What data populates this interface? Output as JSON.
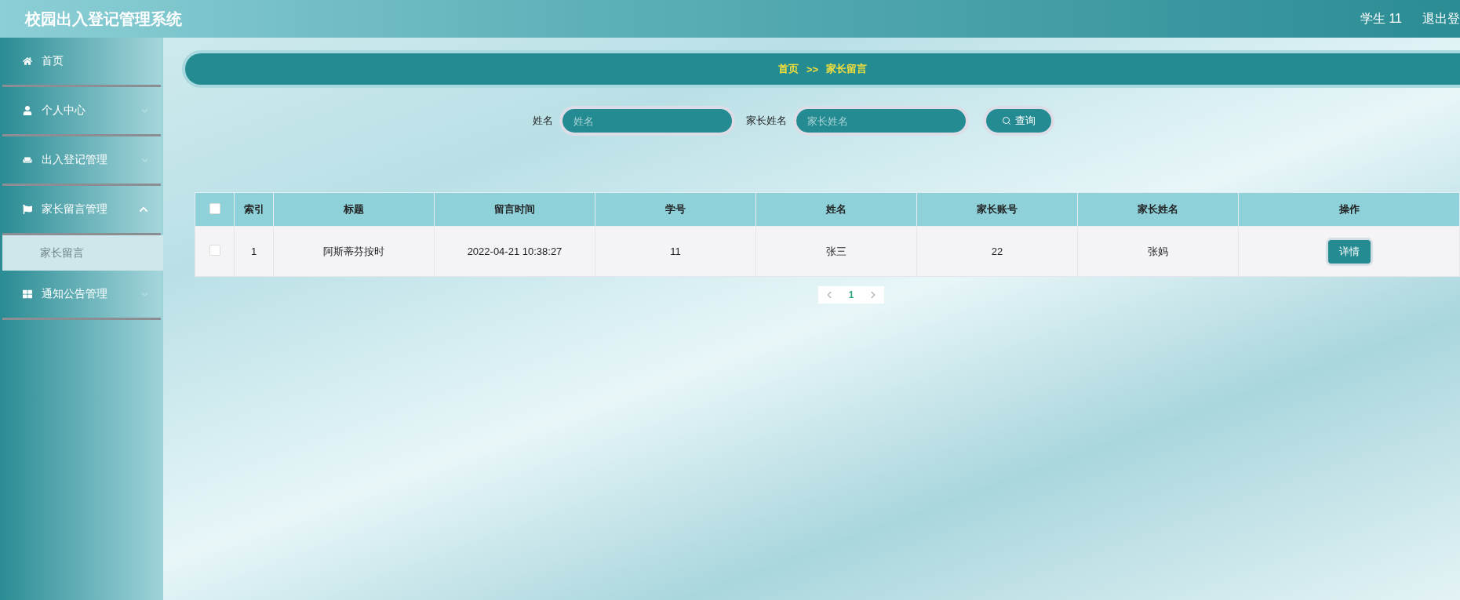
{
  "header": {
    "title": "校园出入登记管理系统",
    "user": "学生 11",
    "logout": "退出登"
  },
  "sidebar": {
    "items": [
      {
        "label": "首页",
        "kind": "link"
      },
      {
        "label": "个人中心",
        "kind": "group",
        "expanded": false
      },
      {
        "label": "出入登记管理",
        "kind": "group",
        "expanded": false
      },
      {
        "label": "家长留言管理",
        "kind": "group",
        "expanded": true,
        "children": [
          {
            "label": "家长留言",
            "selected": true
          }
        ]
      },
      {
        "label": "通知公告管理",
        "kind": "group",
        "expanded": false
      }
    ]
  },
  "breadcrumb": {
    "home": "首页",
    "separator": ">>",
    "current": "家长留言"
  },
  "search": {
    "fields": [
      {
        "label": "姓名",
        "placeholder": "姓名"
      },
      {
        "label": "家长姓名",
        "placeholder": "家长姓名"
      }
    ],
    "button": "查询"
  },
  "table": {
    "select_all": false,
    "columns": [
      "索引",
      "标题",
      "留言时间",
      "学号",
      "姓名",
      "家长账号",
      "家长姓名",
      "操作"
    ],
    "rows": [
      {
        "checked": false,
        "cells": [
          "1",
          "阿斯蒂芬按时",
          "2022-04-21 10:38:27",
          "11",
          "张三",
          "22",
          "张妈"
        ],
        "action": "详情"
      }
    ]
  },
  "pagination": {
    "pages": [
      {
        "label": "1",
        "selected": true
      }
    ]
  }
}
